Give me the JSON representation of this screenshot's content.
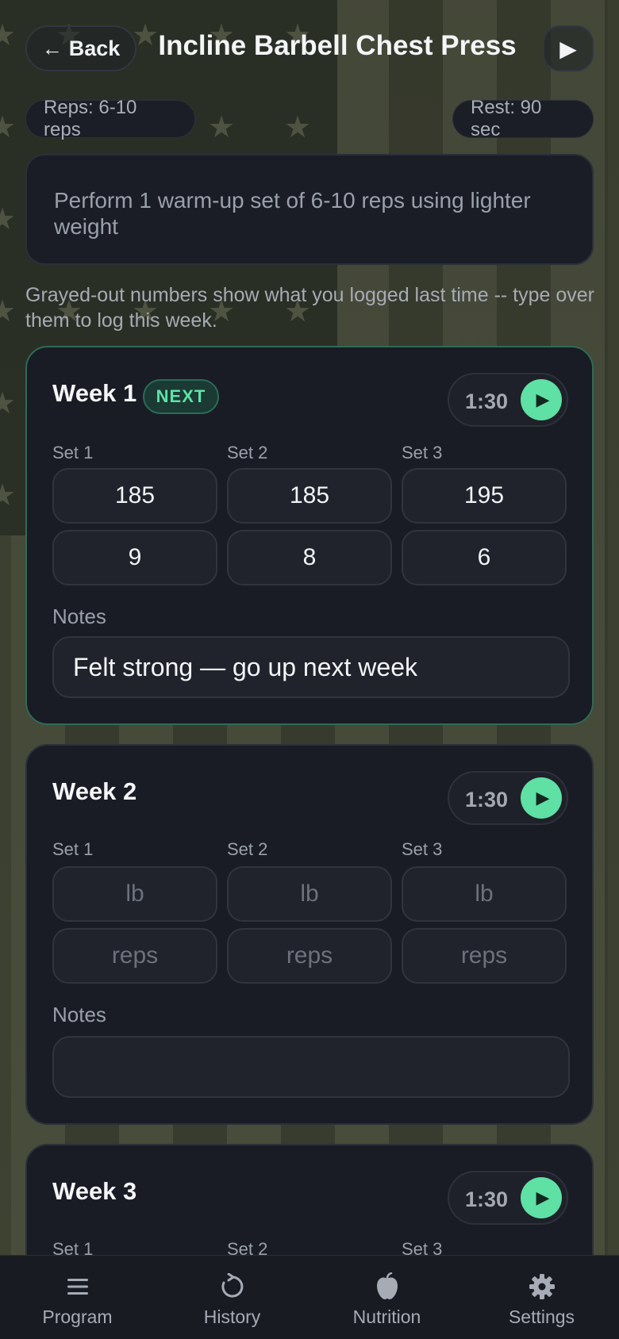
{
  "header": {
    "back_label": "Back",
    "title": "Incline Barbell Chest Press"
  },
  "chips": {
    "reps": "Reps: 6-10 reps",
    "rest": "Rest: 90 sec"
  },
  "instruction": "Perform 1 warm-up set of 6-10 reps using lighter weight",
  "hint": "Grayed-out numbers show what you logged last time -- type over them to log this week.",
  "colors": {
    "accent_green": "#5fe0a4",
    "card_bg": "#191c24",
    "active_border": "#2f6a55"
  },
  "weeks": [
    {
      "title": "Week 1",
      "badge": "NEXT",
      "timer": "1:30",
      "sets": [
        {
          "label": "Set 1",
          "weight": "185",
          "reps": "9"
        },
        {
          "label": "Set 2",
          "weight": "185",
          "reps": "8"
        },
        {
          "label": "Set 3",
          "weight": "195",
          "reps": "6"
        }
      ],
      "notes_label": "Notes",
      "notes": "Felt strong — go up next week"
    },
    {
      "title": "Week 2",
      "timer": "1:30",
      "sets": [
        {
          "label": "Set 1",
          "weight_placeholder": "lb",
          "reps_placeholder": "reps"
        },
        {
          "label": "Set 2",
          "weight_placeholder": "lb",
          "reps_placeholder": "reps"
        },
        {
          "label": "Set 3",
          "weight_placeholder": "lb",
          "reps_placeholder": "reps"
        }
      ],
      "notes_label": "Notes",
      "notes": ""
    },
    {
      "title": "Week 3",
      "timer": "1:30",
      "sets": [
        {
          "label": "Set 1"
        },
        {
          "label": "Set 2"
        },
        {
          "label": "Set 3"
        }
      ]
    }
  ],
  "nav": [
    {
      "label": "Program",
      "icon": "menu-icon"
    },
    {
      "label": "History",
      "icon": "history-icon"
    },
    {
      "label": "Nutrition",
      "icon": "nutrition-icon"
    },
    {
      "label": "Settings",
      "icon": "gear-icon"
    }
  ]
}
